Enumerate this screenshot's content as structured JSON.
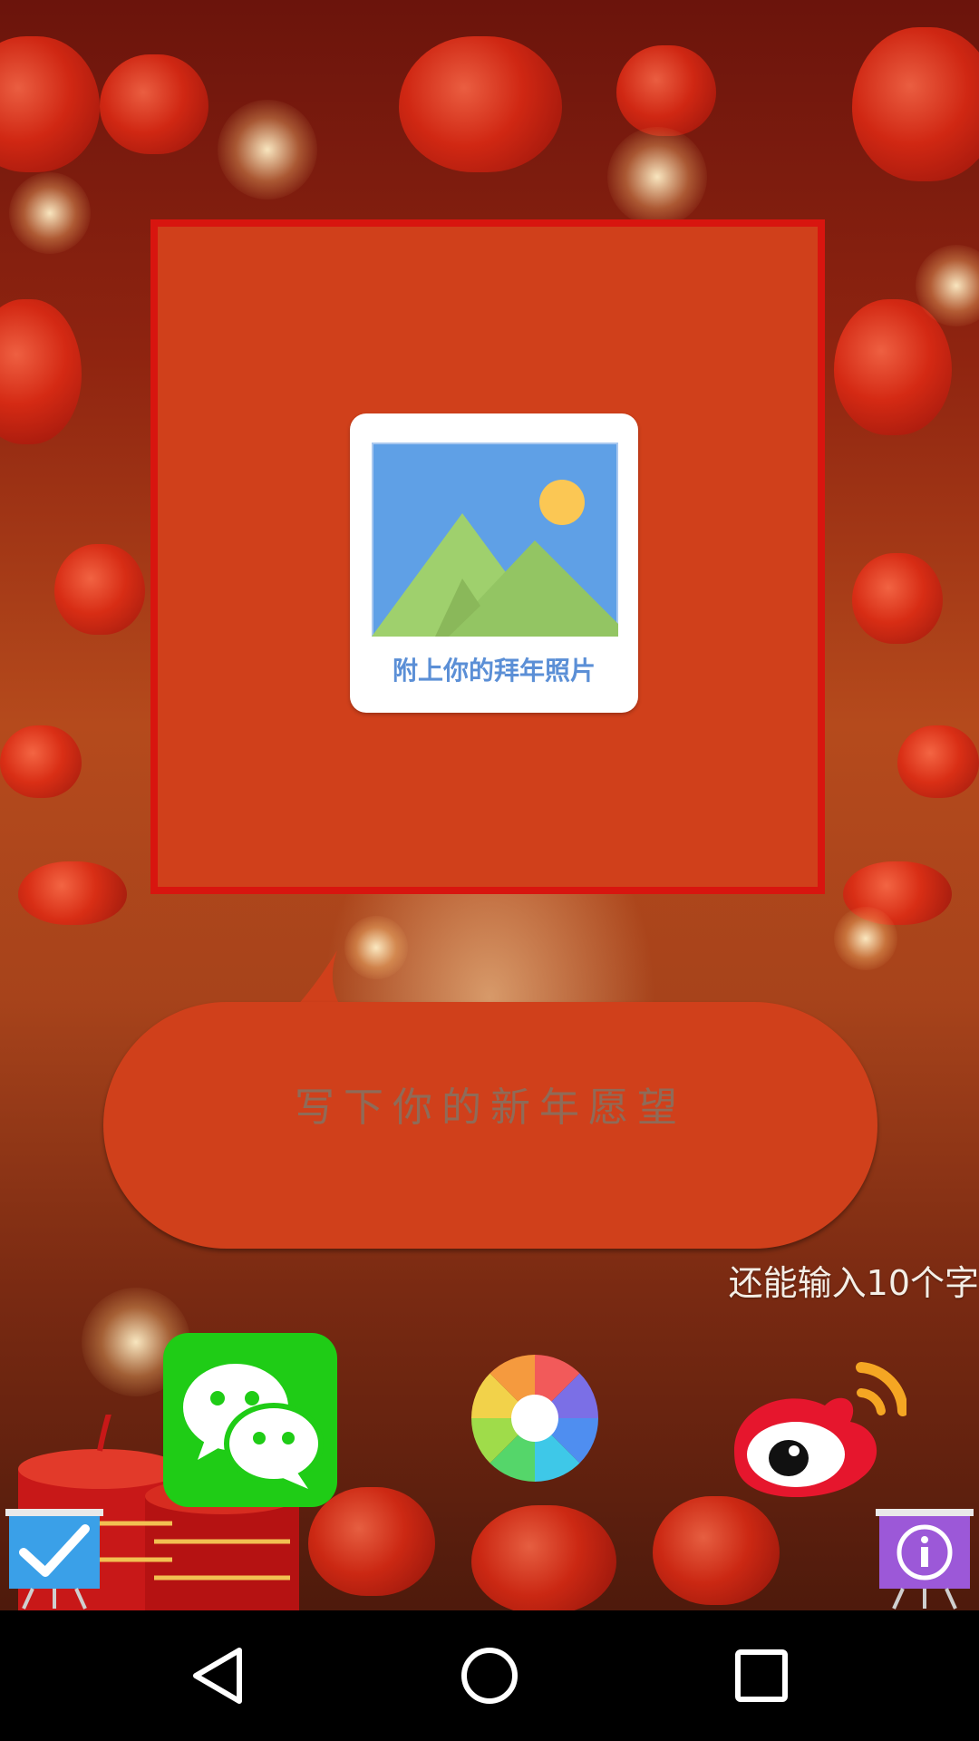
{
  "photo_panel": {
    "label": "附上你的拜年照片"
  },
  "wish_bubble": {
    "placeholder": "写下你的新年愿望",
    "value": ""
  },
  "char_counter": "还能输入10个字",
  "share_options": [
    "wechat-icon",
    "moments-icon",
    "weibo-icon"
  ],
  "corner_buttons": {
    "confirm": "checkmark-icon",
    "info": "info-icon"
  },
  "nav_bar": [
    "back-icon",
    "home-icon",
    "recent-apps-icon"
  ],
  "colors": {
    "panel": "#d0401b",
    "panel_border": "#d8150f",
    "photo_label": "#5b8fd6",
    "wechat": "#1fcc16",
    "weibo": "#e6162d",
    "confirm": "#3aa0e8",
    "info": "#9c58d8"
  }
}
